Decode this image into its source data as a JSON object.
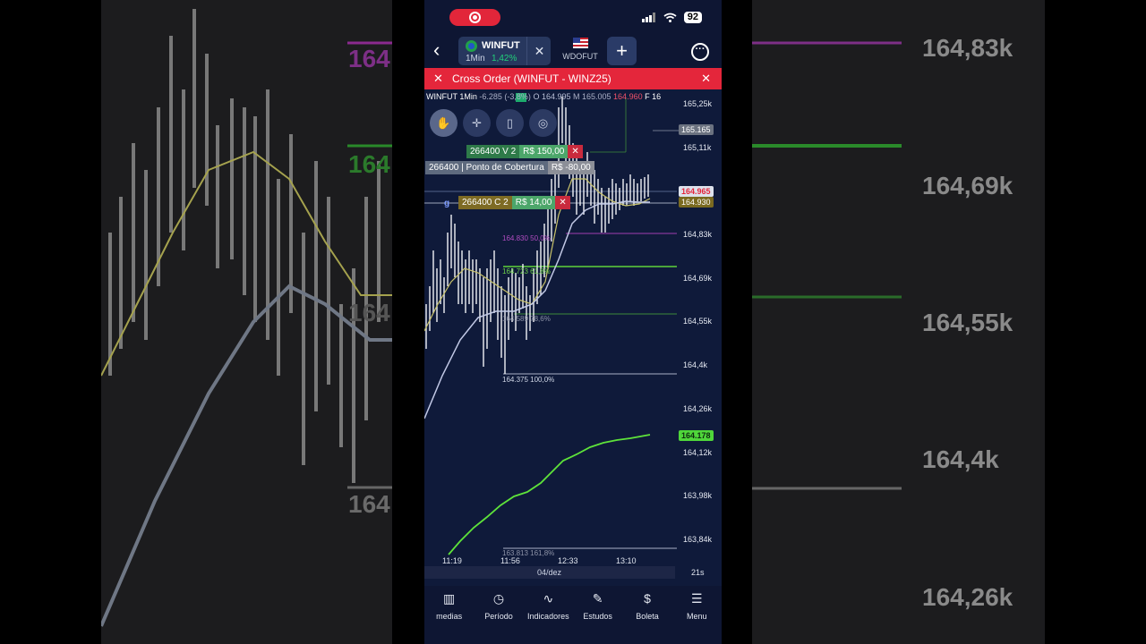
{
  "background": {
    "left_labels": [
      "164",
      "164",
      "164",
      "164"
    ],
    "right_labels": [
      "164,83k",
      "164,69k",
      "164,55k",
      "164,4k",
      "164,26k"
    ]
  },
  "status_bar": {
    "battery": "92"
  },
  "tabs": {
    "active": {
      "symbol": "WINFUT",
      "timeframe": "1Min",
      "change": "1,42%"
    },
    "second": {
      "symbol": "WDOFUT"
    }
  },
  "cross_order": {
    "title": "Cross Order (WINFUT - WINZ25)"
  },
  "ohlc": {
    "symbol": "WINFUT 1Min",
    "change": "-6.285",
    "pct": "(-3,8%)",
    "open": "O 164.995",
    "high": "M 165.005",
    "close": "164.960",
    "suffix": "F 16"
  },
  "orders": {
    "sell": {
      "qty": "266400   V  2",
      "price": "R$ 150,00"
    },
    "cover": {
      "qty": "266400 | Ponto de Cobertura",
      "price": "R$ -80,00"
    },
    "buy": {
      "qty": "266400   C 2",
      "price": "R$ 14,00"
    },
    "g_marker": "g"
  },
  "price_axis": [
    "165,25k",
    "165,11k",
    "164,83k",
    "164,69k",
    "164,55k",
    "164,4k",
    "164,26k",
    "164,12k",
    "163,98k",
    "163,84k"
  ],
  "price_tags": {
    "level": "165.165",
    "last": "164.965",
    "avg": "164.930",
    "ind": "164.178"
  },
  "fib_levels": [
    "164.830  50,0%",
    "164.723  61,8%",
    "164.589  78,6%",
    "164.375  100,0%",
    "163.813  161,8%"
  ],
  "time_axis": [
    "11:19",
    "11:56",
    "12:33",
    "13:10"
  ],
  "date": "04/dez",
  "timer": "21s",
  "bottom_nav": [
    {
      "label": "medias",
      "icon": "panels-icon"
    },
    {
      "label": "Período",
      "icon": "clock-icon"
    },
    {
      "label": "Indicadores",
      "icon": "chart-line-icon"
    },
    {
      "label": "Estudos",
      "icon": "pencil-icon"
    },
    {
      "label": "Boleta",
      "icon": "dollar-icon"
    },
    {
      "label": "Menu",
      "icon": "menu-icon"
    }
  ],
  "colors": {
    "accent_red": "#e4263b",
    "positive": "#21d07a",
    "chart_bg": "#0f1a3a"
  }
}
